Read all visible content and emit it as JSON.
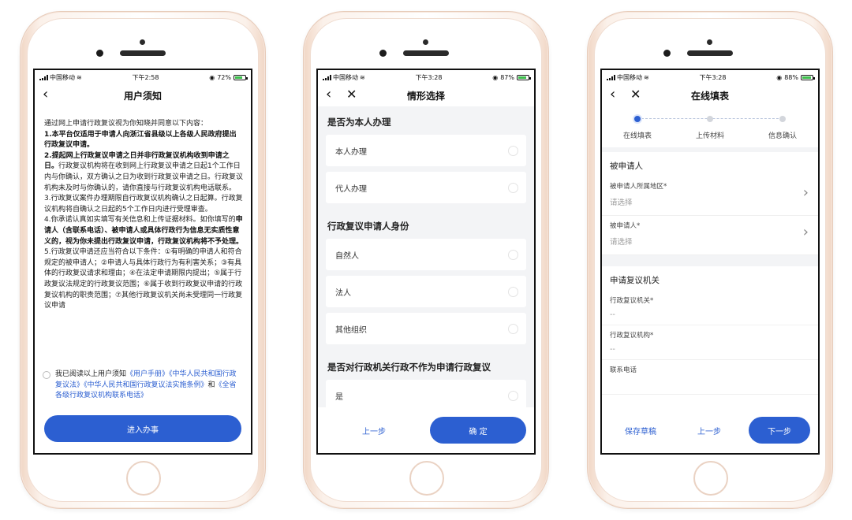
{
  "colors": {
    "accent": "#2c5fd1",
    "battery": "#3dbf4c"
  },
  "screen1": {
    "status": {
      "carrier": "中国移动",
      "time": "下午2:58",
      "battery": "72%",
      "battery_level": 0.72
    },
    "title": "用户须知",
    "intro": "通过网上申请行政复议视为你知晓并同意以下内容：",
    "items": [
      {
        "bold": "1.本平台仅适用于申请人向浙江省县级以上各级人民政府提出行政复议申请。",
        "normal": ""
      },
      {
        "bold": "2.提起网上行政复议申请之日并非行政复议机构收到申请之日。",
        "normal": "行政复议机构将在收到网上行政复议申请之日起1个工作日内与你确认，双方确认之日为收到行政复议申请之日。行政复议机构未及时与你确认的，请你直接与行政复议机构电话联系。"
      },
      {
        "bold": "",
        "normal": "3.行政复议案件办理期限自行政复议机构确认之日起算。行政复议机构将自确认之日起的5个工作日内进行受理审查。"
      },
      {
        "normal_pre": "4.你承诺认真如实填写有关信息和上传证据材料。如你填写的",
        "bold": "申请人（含联系电话）、被申请人或具体行政行为信息无实质性意义的，视为你未提出行政复议申请，行政复议机构将不予处理。"
      },
      {
        "bold": "",
        "normal": "5.行政复议申请还应当符合以下条件：①有明确的申请人和符合规定的被申请人；②申请人与具体行政行为有利害关系；③有具体的行政复议请求和理由；④在法定申请期限内提出；⑤属于行政复议法规定的行政复议范围；⑥属于收到行政复议申请的行政复议机构的职责范围；⑦其他行政复议机关尚未受理同一行政复议申请"
      }
    ],
    "agree_pre": "我已阅读以上用户须知",
    "agree_links": [
      "《用户手册》",
      "《中华人民共和国行政复议法》",
      "《中华人民共和国行政复议法实施条例》"
    ],
    "agree_and": "和",
    "agree_last": "《全省各级行政复议机构联系电话》",
    "button": "进入办事"
  },
  "screen2": {
    "status": {
      "carrier": "中国移动",
      "time": "下午3:28",
      "battery": "87%",
      "battery_level": 0.87
    },
    "title": "情形选择",
    "q1": {
      "title": "是否为本人办理",
      "options": [
        "本人办理",
        "代人办理"
      ]
    },
    "q2": {
      "title": "行政复议申请人身份",
      "options": [
        "自然人",
        "法人",
        "其他组织"
      ]
    },
    "q3": {
      "title": "是否对行政机关行政不作为申请行政复议",
      "options": [
        "是"
      ]
    },
    "prev": "上一步",
    "confirm": "确 定"
  },
  "screen3": {
    "status": {
      "carrier": "中国移动",
      "time": "下午3:28",
      "battery": "88%",
      "battery_level": 0.88
    },
    "title": "在线填表",
    "steps": [
      "在线填表",
      "上传材料",
      "信息确认"
    ],
    "section1": "被申请人",
    "fields1": [
      {
        "label": "被申请人所属地区*",
        "value": "请选择"
      },
      {
        "label": "被申请人*",
        "value": "请选择"
      }
    ],
    "section2": "申请复议机关",
    "fields2": [
      {
        "label": "行政复议机关*",
        "value": "--"
      },
      {
        "label": "行政复议机构*",
        "value": "--"
      },
      {
        "label": "联系电话",
        "value": ""
      }
    ],
    "save": "保存草稿",
    "prev": "上一步",
    "next": "下一步"
  }
}
